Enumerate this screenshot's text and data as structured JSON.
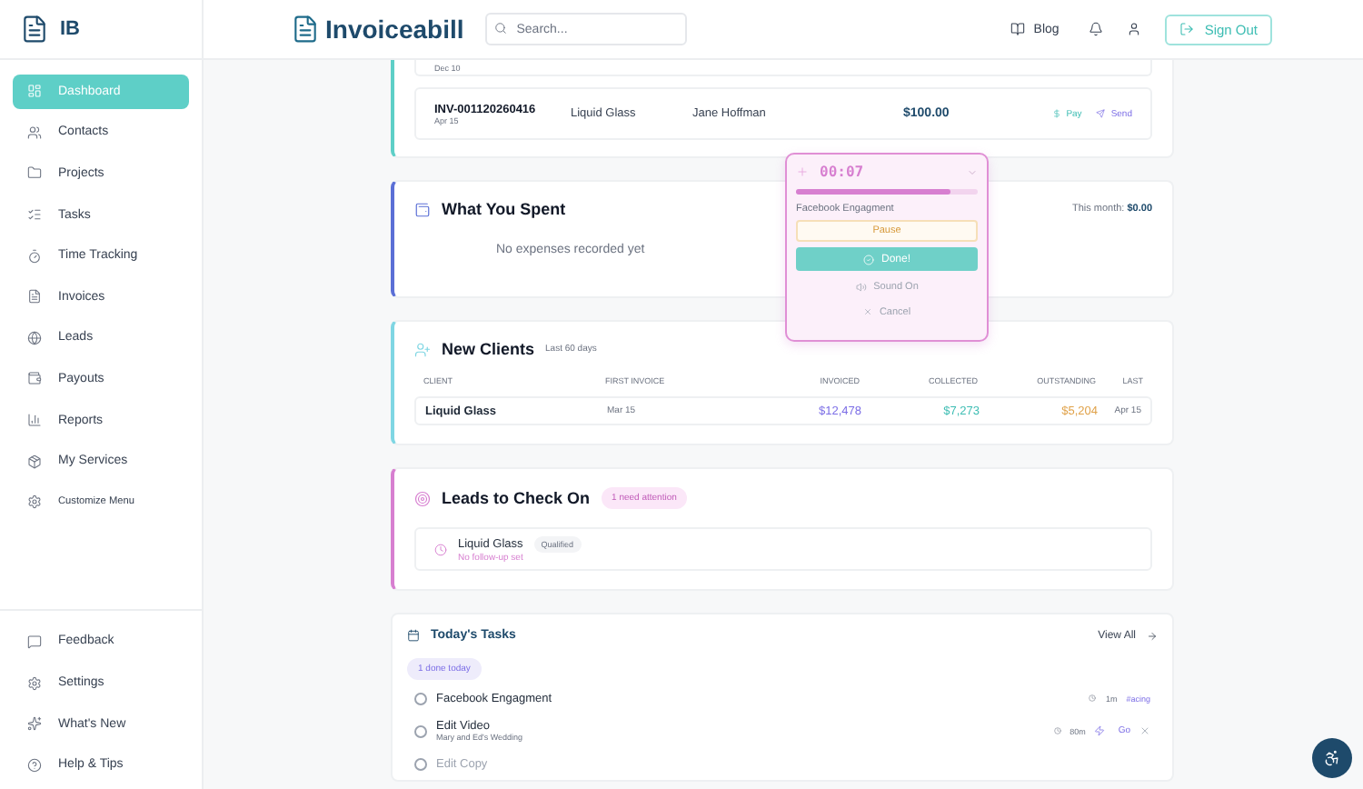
{
  "sidebar": {
    "brand": "IB",
    "items": [
      {
        "label": "Dashboard",
        "selected": true
      },
      {
        "label": "Contacts",
        "selected": false
      },
      {
        "label": "Projects",
        "selected": false
      },
      {
        "label": "Tasks",
        "selected": false
      },
      {
        "label": "Time Tracking",
        "selected": false
      },
      {
        "label": "Invoices",
        "selected": false
      },
      {
        "label": "Leads",
        "selected": false
      },
      {
        "label": "Payouts",
        "selected": false
      },
      {
        "label": "Reports",
        "selected": false
      },
      {
        "label": "My Services",
        "selected": false
      },
      {
        "label": "Customize Menu",
        "selected": false
      }
    ],
    "bottom_items": [
      {
        "label": "Feedback"
      },
      {
        "label": "Settings"
      },
      {
        "label": "What's New"
      },
      {
        "label": "Help & Tips"
      }
    ]
  },
  "header": {
    "logo": "Invoiceabill",
    "search": {
      "placeholder": "Search..."
    },
    "blog": "Blog",
    "sign_out": "Sign Out"
  },
  "invoices": {
    "prev_date": "Dec 10",
    "rows": [
      {
        "number": "INV-001120260416",
        "date": "Apr 15",
        "client": "Liquid Glass",
        "contact": "Jane Hoffman",
        "amount": "$100.00",
        "pay": "Pay",
        "send": "Send"
      }
    ]
  },
  "spent": {
    "title": "What You Spent",
    "month_label": "This month:",
    "month_value": "$0.00",
    "empty": "No expenses recorded yet"
  },
  "new_clients": {
    "title": "New Clients",
    "subtitle": "Last 60 days",
    "columns": [
      "CLIENT",
      "FIRST INVOICE",
      "INVOICED",
      "COLLECTED",
      "OUTSTANDING",
      "LAST"
    ],
    "rows": [
      {
        "client": "Liquid Glass",
        "first_invoice": "Mar 15",
        "invoiced": "$12,478",
        "collected": "$7,273",
        "outstanding": "$5,204",
        "last": "Apr 15"
      }
    ]
  },
  "leads": {
    "title": "Leads to Check On",
    "badge": "1 need attention",
    "items": [
      {
        "name": "Liquid Glass",
        "status": "Qualified",
        "note": "No follow-up set"
      }
    ]
  },
  "tasks": {
    "title": "Today's Tasks",
    "view_all": "View All",
    "done_badge": "1 done today",
    "items": [
      {
        "title": "Facebook Engagment",
        "checked": false,
        "time": "1m",
        "tag": "#acing"
      },
      {
        "title": "Edit Video",
        "checked": false,
        "project": "Mary and Ed's Wedding",
        "time": "80m",
        "go": "Go"
      },
      {
        "title": "Edit Copy",
        "checked": false
      }
    ]
  },
  "timer": {
    "time": "00:07",
    "level": 0.85,
    "task": "Facebook Engagment",
    "pause": "Pause",
    "done": "Done!",
    "sound": "Sound On",
    "cancel": "Cancel"
  }
}
